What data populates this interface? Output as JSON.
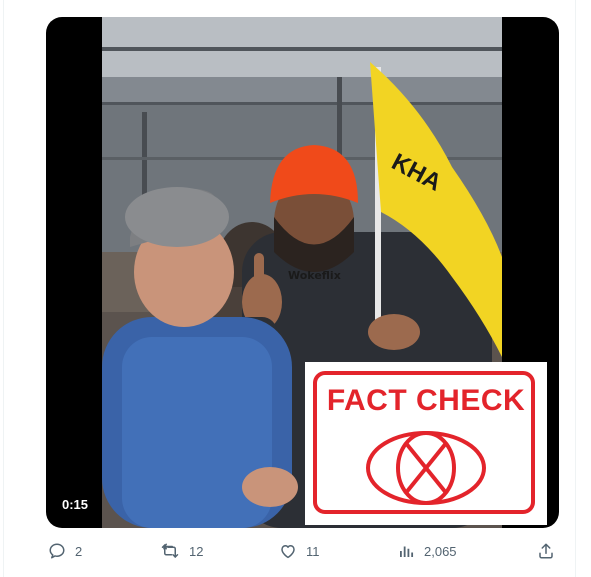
{
  "video": {
    "duration": "0:15",
    "watermark": "Wokeflix",
    "overlay": {
      "stamp_text": "FACT CHECK",
      "stamp_color": "#e3242b"
    },
    "flag_text": "KHA",
    "flag_color": "#f2d423"
  },
  "actions": {
    "reply": {
      "icon": "reply-icon",
      "count": "2"
    },
    "retweet": {
      "icon": "retweet-icon",
      "count": "12"
    },
    "like": {
      "icon": "heart-icon",
      "count": "11"
    },
    "views": {
      "icon": "views-icon",
      "count": "2,065"
    },
    "share": {
      "icon": "share-icon"
    }
  },
  "colors": {
    "icon_gray": "#536471",
    "card_bg": "#000000"
  }
}
